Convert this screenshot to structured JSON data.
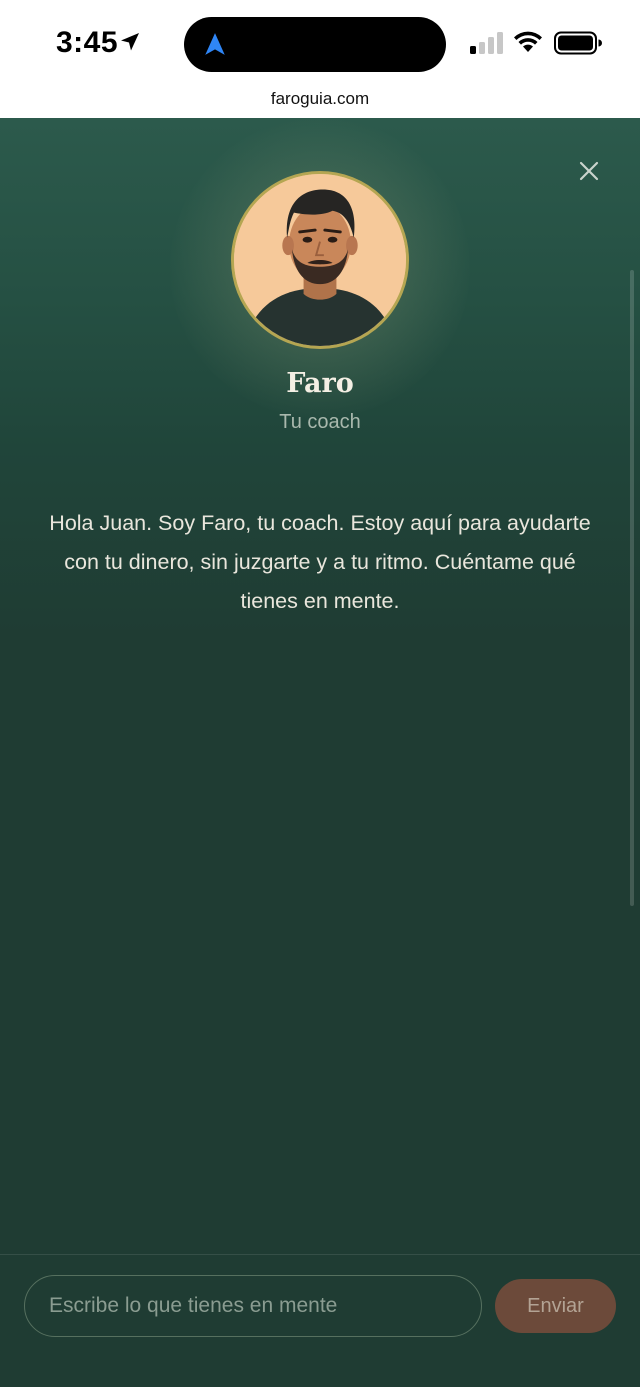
{
  "status_bar": {
    "time": "3:45",
    "location_icon": "location-arrow-icon",
    "island_icon": "navigation-arrow-icon",
    "signal_icon": "cellular-signal-icon",
    "wifi_icon": "wifi-icon",
    "battery_icon": "battery-icon"
  },
  "browser": {
    "url": "faroguia.com"
  },
  "coach": {
    "name": "Faro",
    "role": "Tu coach",
    "avatar_icon": "coach-portrait"
  },
  "chat": {
    "close_icon": "close-icon",
    "welcome_message": "Hola Juan. Soy Faro, tu coach. Estoy aquí para ayudarte con tu dinero, sin juzgarte y a tu ritmo. Cuéntame qué tienes en mente."
  },
  "composer": {
    "placeholder": "Escribe lo que tienes en mente",
    "value": "",
    "send_label": "Enviar"
  },
  "colors": {
    "background": "#1f3c33",
    "header_gradient_top": "#2c5a4c",
    "avatar_ring": "#b5a652",
    "send_button": "#6c4a3a",
    "text_primary": "#e9e6dc",
    "text_muted": "#a9b8ad"
  }
}
